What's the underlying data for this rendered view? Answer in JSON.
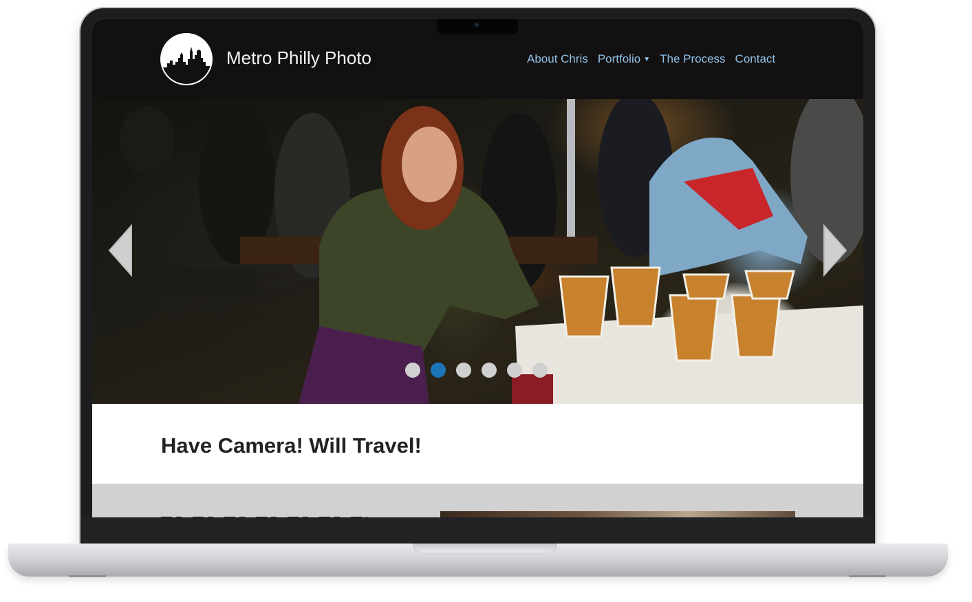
{
  "header": {
    "site_title": "Metro Philly Photo",
    "logo_icon": "philadelphia-skyline-logo-icon"
  },
  "nav": {
    "items": [
      {
        "label": "About Chris"
      },
      {
        "label": "Portfolio",
        "has_dropdown": true
      },
      {
        "label": "The Process"
      },
      {
        "label": "Contact"
      }
    ],
    "link_color": "#8fc2ea"
  },
  "slider": {
    "prev_icon": "chevron-left-icon",
    "next_icon": "chevron-right-icon",
    "slide_count": 6,
    "active_index": 1,
    "active_color": "#1c75b9",
    "inactive_color": "#d0d0d0"
  },
  "tagline": "Have Camera! Will Travel!",
  "colors": {
    "header_bg": "#121010",
    "gray_band": "#d1d1d1"
  }
}
